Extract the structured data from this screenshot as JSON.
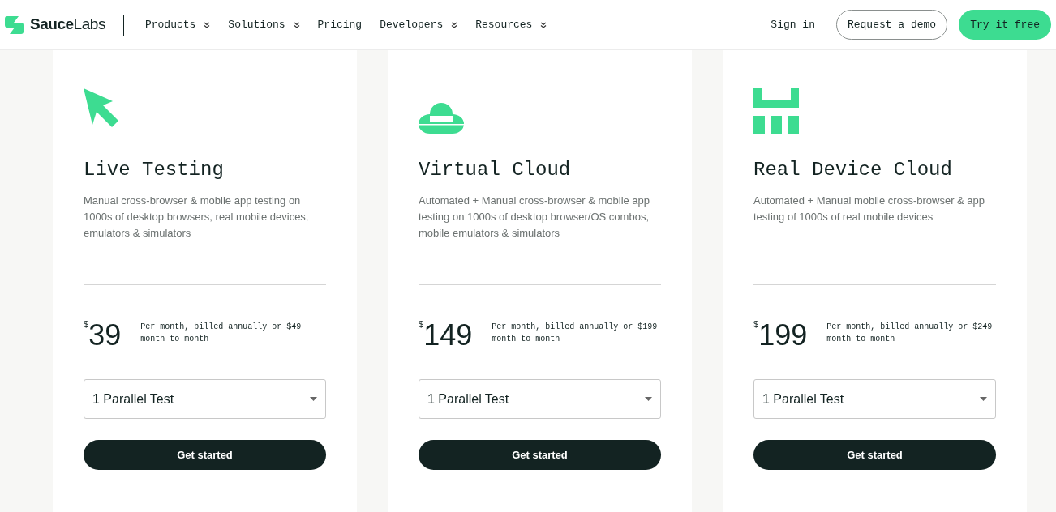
{
  "nav": {
    "logo": {
      "bold": "Sauce",
      "light": "Labs"
    },
    "items": [
      {
        "label": "Products",
        "dropdown": true
      },
      {
        "label": "Solutions",
        "dropdown": true
      },
      {
        "label": "Pricing",
        "dropdown": false
      },
      {
        "label": "Developers",
        "dropdown": true
      },
      {
        "label": "Resources",
        "dropdown": true
      }
    ],
    "sign_in": "Sign in",
    "demo_button": "Request a demo",
    "trial_button": "Try it free"
  },
  "plans": [
    {
      "kind": "cursor",
      "title": "Live Testing",
      "description": "Manual cross-browser & mobile app testing on 1000s of desktop browsers, real mobile devices, emulators & simulators",
      "currency": "$",
      "price": "39",
      "price_note": "Per month, billed annually or $49 month to month",
      "select_value": "1 Parallel Test",
      "button": "Get started"
    },
    {
      "kind": "cloud",
      "title": "Virtual Cloud",
      "description": "Automated + Manual cross-browser & mobile app testing on 1000s of desktop browser/OS combos, mobile emulators & simulators",
      "currency": "$",
      "price": "149",
      "price_note": "Per month, billed annually or $199 month to month",
      "select_value": "1 Parallel Test",
      "button": "Get started"
    },
    {
      "kind": "blocks",
      "title": "Real Device Cloud",
      "description": "Automated + Manual mobile cross-browser & app testing of 1000s of real mobile devices",
      "currency": "$",
      "price": "199",
      "price_note": "Per month, billed annually or $249 month to month",
      "select_value": "1 Parallel Test",
      "button": "Get started"
    }
  ]
}
